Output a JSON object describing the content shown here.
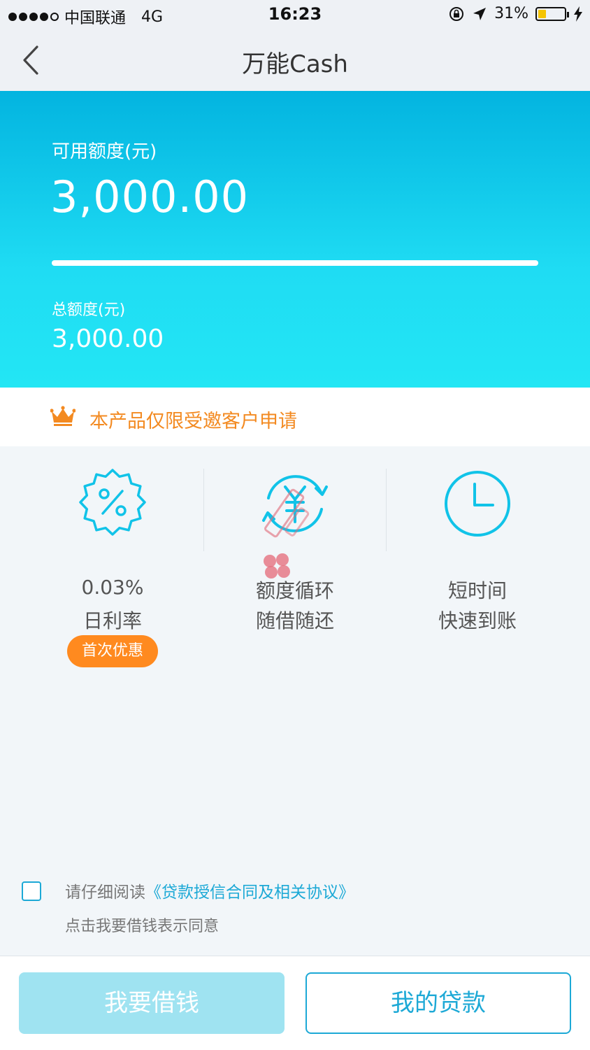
{
  "status_bar": {
    "carrier": "中国联通",
    "network": "4G",
    "time": "16:23",
    "battery_percent": "31%",
    "battery_level": 0.31
  },
  "nav": {
    "title": "万能Cash"
  },
  "credit": {
    "available_label": "可用额度(元)",
    "available_value": "3,000.00",
    "total_label": "总额度(元)",
    "total_value": "3,000.00",
    "usage_fraction": 1.0
  },
  "notice": {
    "text": "本产品仅限受邀客户申请"
  },
  "features": [
    {
      "line1": "0.03%",
      "line2": "日利率",
      "badge": "首次优惠",
      "icon": "percent-badge-icon"
    },
    {
      "line1": "额度循环",
      "line2": "随借随还",
      "icon": "yuan-cycle-icon"
    },
    {
      "line1": "短时间",
      "line2": "快速到账",
      "icon": "clock-icon"
    }
  ],
  "agreement": {
    "prefix": "请仔细阅读",
    "link": "《贷款授信合同及相关协议》",
    "note": "点击我要借钱表示同意",
    "checked": false
  },
  "buttons": {
    "borrow": "我要借钱",
    "my_loans": "我的贷款"
  },
  "colors": {
    "primary": "#1da9d6",
    "hero_top": "#03b4e0",
    "hero_bottom": "#23e6f4",
    "accent_orange": "#f38a21",
    "badge_orange": "#ff8a1f",
    "disabled_button": "#9fe3f1"
  }
}
